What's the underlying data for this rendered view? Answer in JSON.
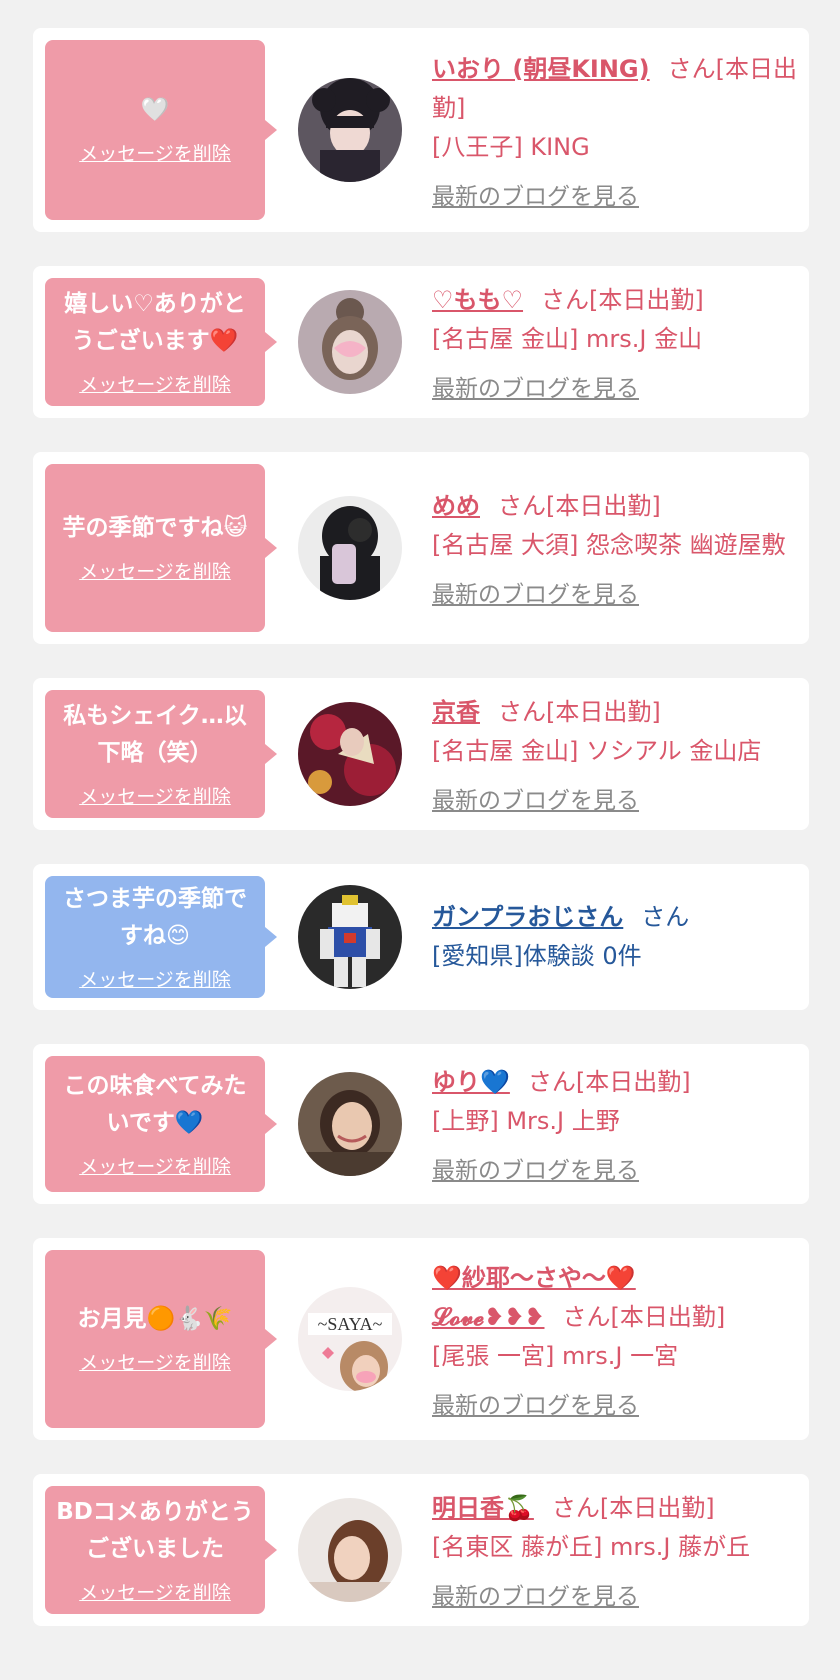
{
  "cards": [
    {
      "bubble_color": "#ef9ba8",
      "message": "🤍",
      "delete_label": "メッセージを削除",
      "name": "いおり (朝昼KING)",
      "suffix": "さん[本日出勤]",
      "shop": "[八王子] KING",
      "blog_label": "最新のブログを見る"
    },
    {
      "bubble_color": "#ef9ba8",
      "message": "嬉しい♡ありがとうございます❤️",
      "delete_label": "メッセージを削除",
      "name": "♡もも♡",
      "suffix": "さん[本日出勤]",
      "shop": "[名古屋 金山] mrs.J 金山",
      "blog_label": "最新のブログを見る"
    },
    {
      "bubble_color": "#ef9ba8",
      "message": "芋の季節ですね😺",
      "delete_label": "メッセージを削除",
      "name": "めめ",
      "suffix": "さん[本日出勤]",
      "shop": "[名古屋 大須] 怨念喫茶 幽遊屋敷",
      "blog_label": "最新のブログを見る"
    },
    {
      "bubble_color": "#ef9ba8",
      "message": "私もシェイク…以下略（笑）",
      "delete_label": "メッセージを削除",
      "name": "京香",
      "suffix": "さん[本日出勤]",
      "shop": "[名古屋 金山] ソシアル 金山店",
      "blog_label": "最新のブログを見る"
    },
    {
      "bubble_color": "#93b6ee",
      "message": "さつま芋の季節ですね😊",
      "delete_label": "メッセージを削除",
      "name": "ガンプラおじさん",
      "suffix": "さん",
      "shop": "[愛知県]体験談 0件",
      "blog_label": ""
    },
    {
      "bubble_color": "#ef9ba8",
      "message": "この味食べてみたいです💙",
      "delete_label": "メッセージを削除",
      "name": "ゆり💙",
      "suffix": "さん[本日出勤]",
      "shop": "[上野] Mrs.J 上野",
      "blog_label": "最新のブログを見る"
    },
    {
      "bubble_color": "#ef9ba8",
      "message": "お月見🟠🐇🌾",
      "delete_label": "メッセージを削除",
      "name": "❤️紗耶〜さや〜❤️",
      "name_line2": "𝓛𝓸𝓿𝓮❥❥❥",
      "suffix": "さん[本日出勤]",
      "shop": "[尾張 一宮] mrs.J 一宮",
      "blog_label": "最新のブログを見る"
    },
    {
      "bubble_color": "#ef9ba8",
      "message": "BDコメありがとうございました",
      "delete_label": "メッセージを削除",
      "name": "明日香🍒",
      "suffix": "さん[本日出勤]",
      "shop": "[名東区 藤が丘] mrs.J 藤が丘",
      "blog_label": "最新のブログを見る"
    }
  ]
}
